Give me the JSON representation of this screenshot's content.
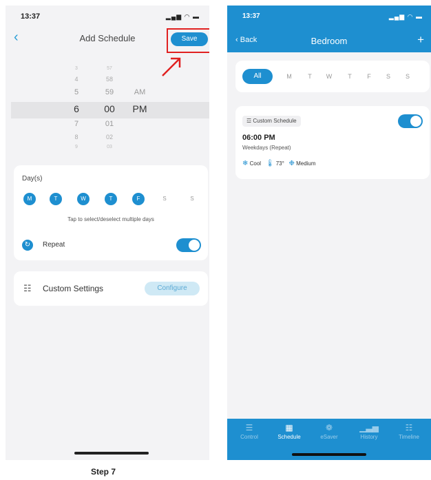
{
  "left": {
    "status_time": "13:37",
    "status_icons": "▂▄▆ ◠ ▬",
    "back_glyph": "‹",
    "title": "Add Schedule",
    "save_label": "Save",
    "picker": {
      "hours": [
        "3",
        "4",
        "5",
        "6",
        "7",
        "8",
        "9"
      ],
      "minutes": [
        "57",
        "58",
        "59",
        "00",
        "01",
        "02",
        "03"
      ],
      "ampm": [
        "",
        "",
        "AM",
        "PM",
        "",
        "",
        ""
      ]
    },
    "days_title": "Day(s)",
    "days": [
      {
        "label": "M",
        "selected": true
      },
      {
        "label": "T",
        "selected": true
      },
      {
        "label": "W",
        "selected": true
      },
      {
        "label": "T",
        "selected": true
      },
      {
        "label": "F",
        "selected": true
      },
      {
        "label": "S",
        "selected": false
      },
      {
        "label": "S",
        "selected": false
      }
    ],
    "days_hint": "Tap to select/deselect multiple days",
    "repeat_label": "Repeat",
    "repeat_on": true,
    "custom_settings_label": "Custom Settings",
    "configure_label": "Configure"
  },
  "step_label": "Step 7",
  "right": {
    "status_time": "13:37",
    "status_icons": "▂▄▆ ◠ ▬",
    "back_label": "Back",
    "title": "Bedroom",
    "add_glyph": "+",
    "filters": [
      "All",
      "M",
      "T",
      "W",
      "T",
      "F",
      "S",
      "S"
    ],
    "active_filter": "All",
    "schedule": {
      "chip_label": "Custom Schedule",
      "time": "06:00 PM",
      "repeat_text": "Weekdays (Repeat)",
      "mode": "Cool",
      "temperature": "73°",
      "fan": "Medium",
      "enabled": true
    },
    "tabs": [
      {
        "label": "Control",
        "icon": "☰",
        "active": false
      },
      {
        "label": "Schedule",
        "icon": "▦",
        "active": true
      },
      {
        "label": "eSaver",
        "icon": "❁",
        "active": false
      },
      {
        "label": "History",
        "icon": "▁▃▅",
        "active": false
      },
      {
        "label": "Timeline",
        "icon": "☷",
        "active": false
      }
    ]
  },
  "colors": {
    "accent": "#1e8fd0",
    "highlight": "#e02020",
    "background": "#f3f3f5"
  }
}
